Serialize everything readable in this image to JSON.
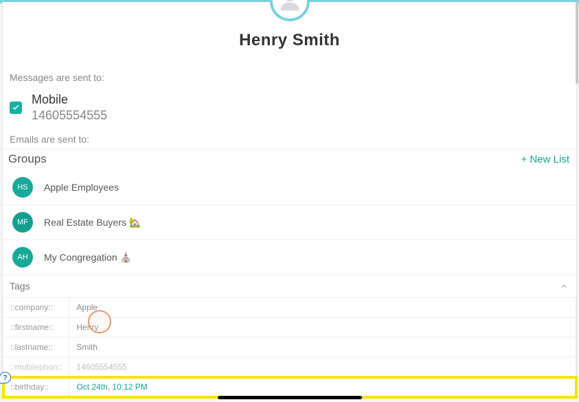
{
  "contact": {
    "full_name": "Henry  Smith"
  },
  "messages": {
    "section_label": "Messages are sent to:",
    "channel_label": "Mobile",
    "channel_value": "14605554555"
  },
  "emails": {
    "section_label": "Emails are sent to:"
  },
  "groups": {
    "title": "Groups",
    "new_list_label": "+ New List",
    "items": [
      {
        "initials": "HS",
        "color": "#18a99b",
        "name": "Apple Employees"
      },
      {
        "initials": "MF",
        "color": "#14a08f",
        "name": "Real Estate Buyers 🏡"
      },
      {
        "initials": "AH",
        "color": "#1aa897",
        "name": "My Congregation ⛪"
      }
    ]
  },
  "tags": {
    "title": "Tags",
    "rows": [
      {
        "key": "::company::",
        "value": "Apple",
        "link": false
      },
      {
        "key": "::firstname::",
        "value": "Henry",
        "link": false
      },
      {
        "key": "::lastname::",
        "value": "Smith",
        "link": false
      },
      {
        "key": "::mobilephon::",
        "value": "14605554555",
        "link": false
      },
      {
        "key": "::birthday::",
        "value": "Oct 24th, 10:12 PM",
        "link": true
      }
    ]
  },
  "help_label": "?"
}
